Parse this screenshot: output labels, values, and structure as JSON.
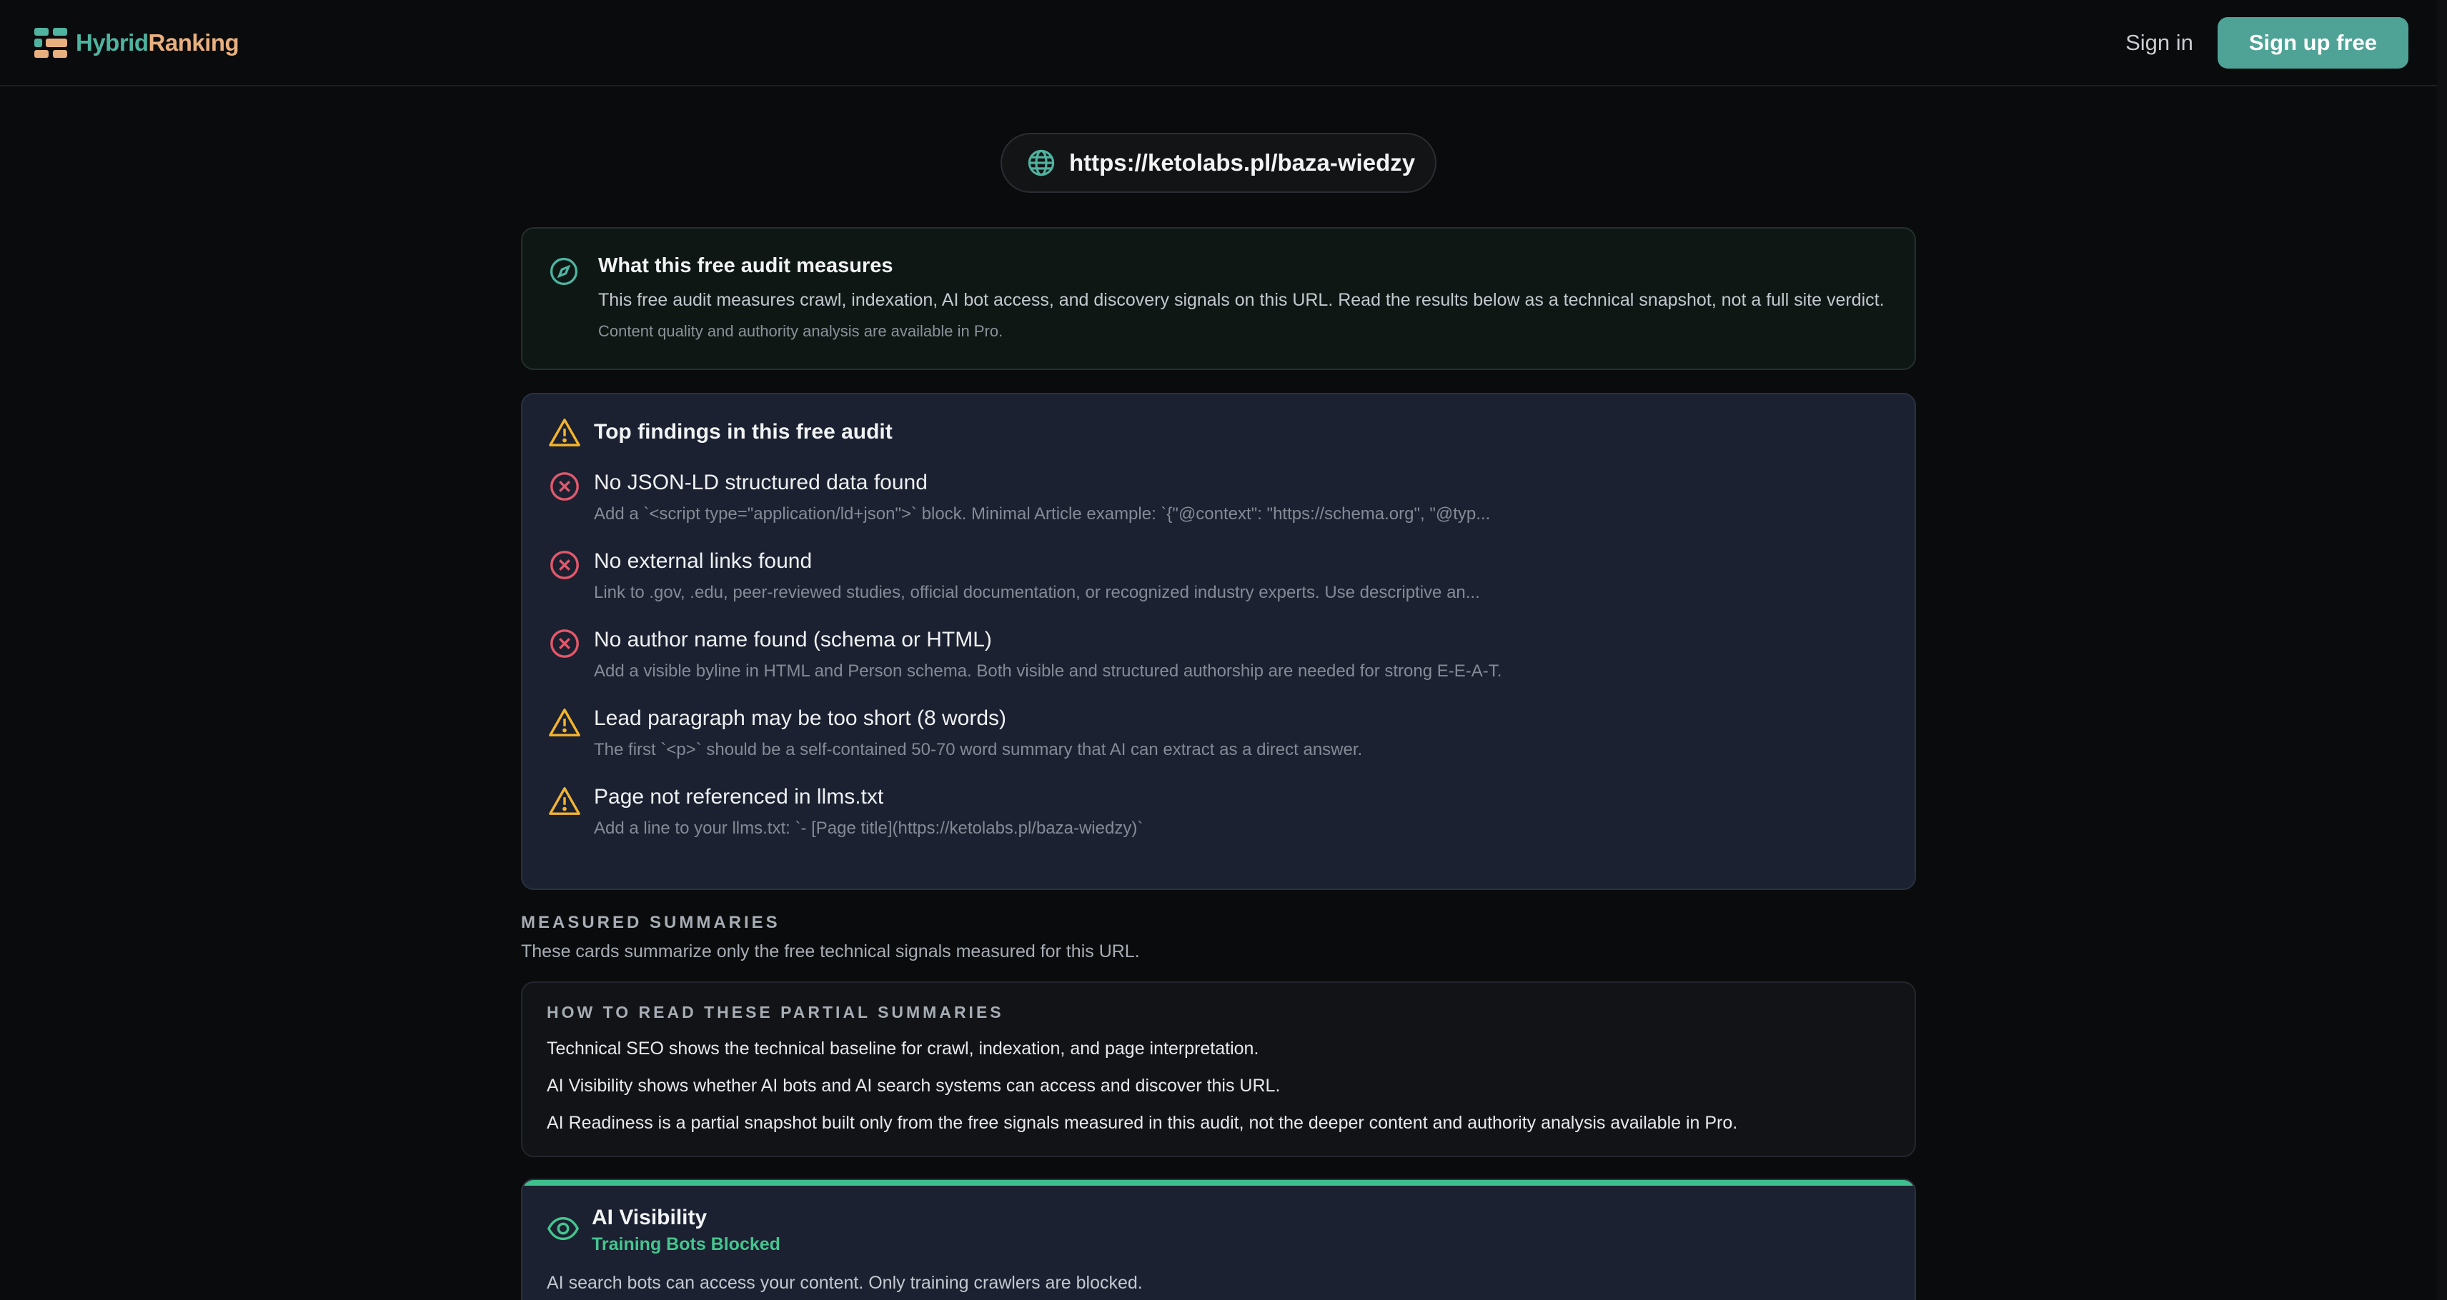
{
  "header": {
    "logo_part1": "Hybrid",
    "logo_part2": "Ranking",
    "signin_label": "Sign in",
    "signup_label": "Sign up free"
  },
  "url_bar": {
    "url": "https://ketolabs.pl/baza-wiedzy",
    "icon": "globe-icon"
  },
  "intro": {
    "icon": "compass-icon",
    "title": "What this free audit measures",
    "text": "This free audit measures crawl, indexation, AI bot access, and discovery signals on this URL. Read the results below as a technical snapshot, not a full site verdict.",
    "subtext": "Content quality and authority analysis are available in Pro."
  },
  "findings": {
    "title": "Top findings in this free audit",
    "items": [
      {
        "severity": "error",
        "title": "No JSON-LD structured data found",
        "description": "Add a `<script type=\"application/ld+json\">` block. Minimal Article example: `{\"@context\": \"https://schema.org\", \"@typ..."
      },
      {
        "severity": "error",
        "title": "No external links found",
        "description": "Link to .gov, .edu, peer-reviewed studies, official documentation, or recognized industry experts. Use descriptive an..."
      },
      {
        "severity": "error",
        "title": "No author name found (schema or HTML)",
        "description": "Add a visible byline in HTML and Person schema. Both visible and structured authorship are needed for strong E-E-A-T."
      },
      {
        "severity": "warning",
        "title": "Lead paragraph may be too short (8 words)",
        "description": "The first `<p>` should be a self-contained 50-70 word summary that AI can extract as a direct answer."
      },
      {
        "severity": "warning",
        "title": "Page not referenced in llms.txt",
        "description": "Add a line to your llms.txt: `- [Page title](https://ketolabs.pl/baza-wiedzy)`"
      }
    ]
  },
  "summaries": {
    "label": "MEASURED SUMMARIES",
    "subtitle": "These cards summarize only the free technical signals measured for this URL.",
    "read_card": {
      "title": "HOW TO READ THESE PARTIAL SUMMARIES",
      "lines": [
        "Technical SEO shows the technical baseline for crawl, indexation, and page interpretation.",
        "AI Visibility shows whether AI bots and AI search systems can access and discover this URL.",
        "AI Readiness is a partial snapshot built only from the free signals measured in this audit, not the deeper content and authority analysis available in Pro."
      ]
    }
  },
  "ai_visibility": {
    "icon": "eye-icon",
    "title": "AI Visibility",
    "status": "Training Bots Blocked",
    "description": "AI search bots can access your content. Only training crawlers are blocked."
  },
  "colors": {
    "accent": "#4fa396",
    "error": "#e2586b",
    "warning": "#f2b431",
    "success": "#45c58f"
  }
}
